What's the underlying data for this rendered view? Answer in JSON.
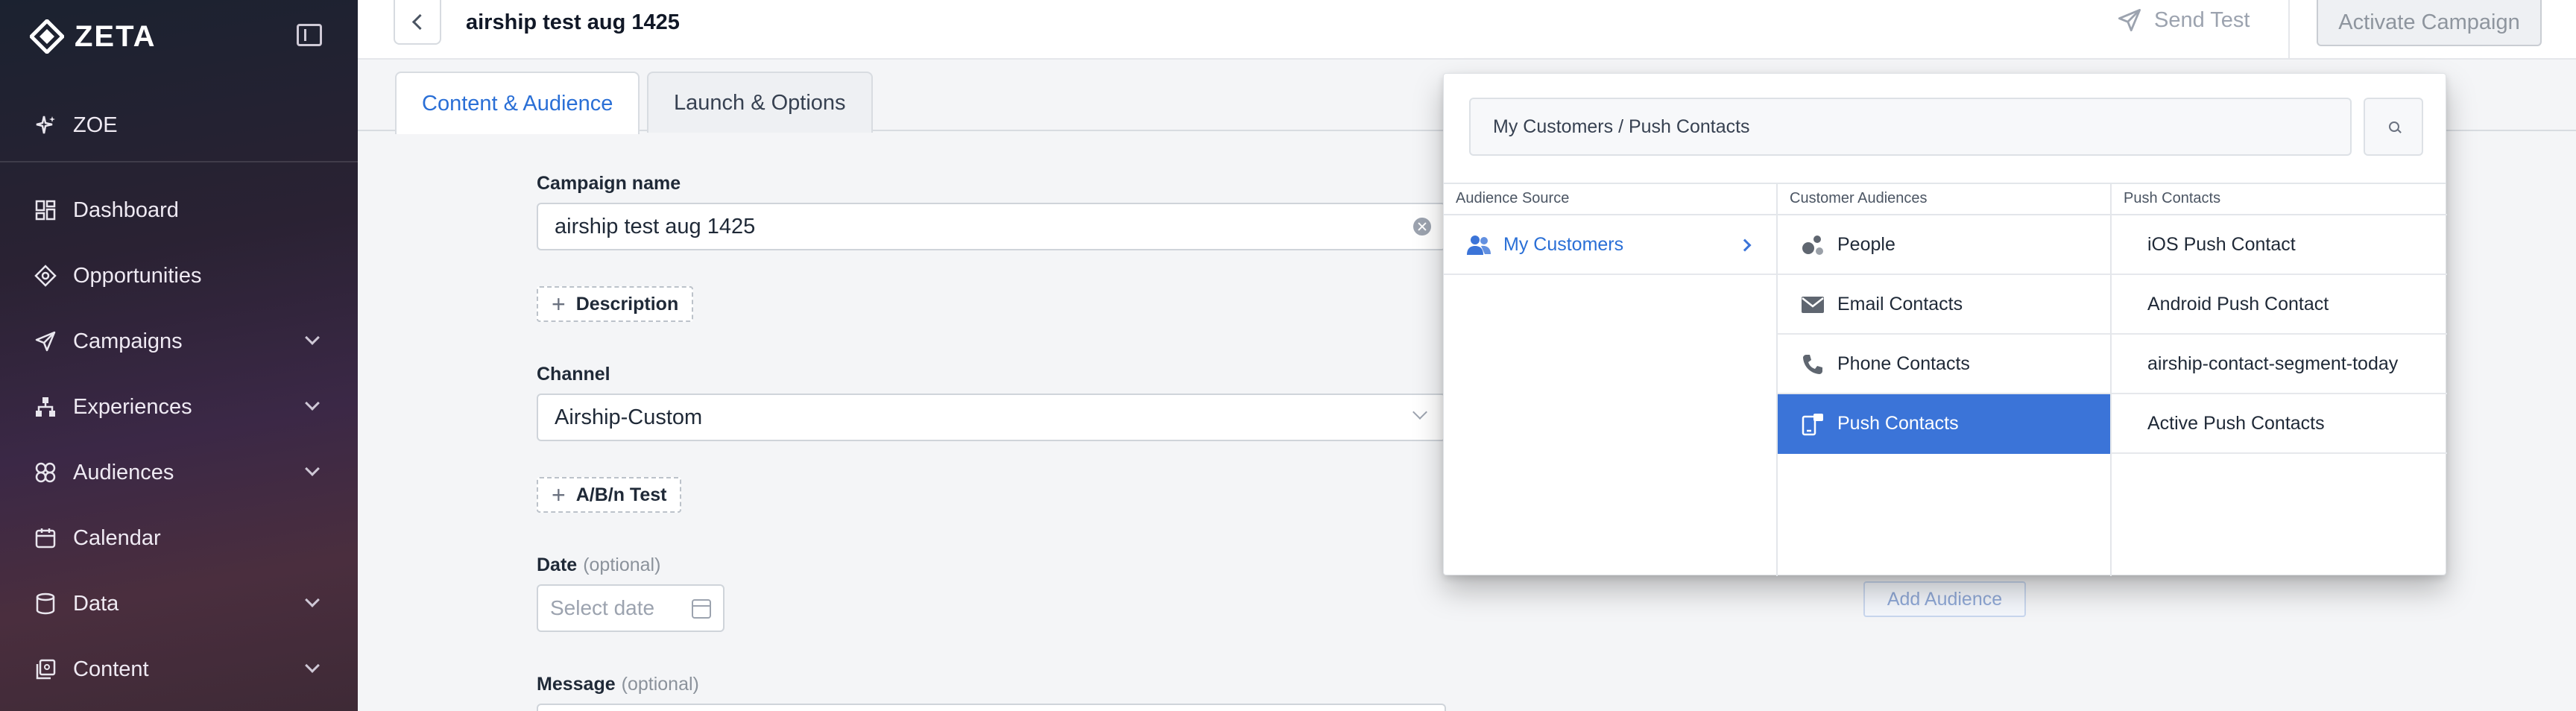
{
  "app": {
    "logo_text": "ZETA"
  },
  "sidebar": {
    "items": [
      {
        "label": "ZOE",
        "icon": "sparkle-icon",
        "expandable": false
      },
      {
        "label": "Dashboard",
        "icon": "grid-icon",
        "expandable": false
      },
      {
        "label": "Opportunities",
        "icon": "target-icon",
        "expandable": false
      },
      {
        "label": "Campaigns",
        "icon": "send-icon",
        "expandable": true
      },
      {
        "label": "Experiences",
        "icon": "hierarchy-icon",
        "expandable": true
      },
      {
        "label": "Audiences",
        "icon": "audience-icon",
        "expandable": true
      },
      {
        "label": "Calendar",
        "icon": "calendar-icon",
        "expandable": false
      },
      {
        "label": "Data",
        "icon": "database-icon",
        "expandable": true
      },
      {
        "label": "Content",
        "icon": "content-icon",
        "expandable": true
      }
    ]
  },
  "header": {
    "campaign_title": "airship test aug 1425",
    "send_test_label": "Send Test",
    "activate_label": "Activate Campaign"
  },
  "tabs": [
    {
      "label": "Content & Audience",
      "active": true
    },
    {
      "label": "Launch & Options",
      "active": false
    }
  ],
  "form": {
    "campaign_name_label": "Campaign name",
    "campaign_name_value": "airship test aug 1425",
    "description_button": "Description",
    "channel_label": "Channel",
    "channel_value": "Airship-Custom",
    "ab_test_button": "A/B/n Test",
    "date_label": "Date",
    "date_optional": "(optional)",
    "date_placeholder": "Select date",
    "message_label": "Message",
    "message_optional": "(optional)"
  },
  "audience_picker": {
    "path": "My Customers  / Push Contacts",
    "columns": {
      "source": {
        "header": "Audience Source",
        "items": [
          {
            "label": "My Customers",
            "selected": false
          }
        ]
      },
      "customer_audiences": {
        "header": "Customer Audiences",
        "items": [
          {
            "label": "People",
            "icon": "people-dots-icon",
            "selected": false
          },
          {
            "label": "Email Contacts",
            "icon": "envelope-icon",
            "selected": false
          },
          {
            "label": "Phone Contacts",
            "icon": "phone-icon",
            "selected": false
          },
          {
            "label": "Push Contacts",
            "icon": "push-device-icon",
            "selected": true
          }
        ]
      },
      "push_contacts": {
        "header": "Push Contacts",
        "items": [
          {
            "label": "iOS Push Contact"
          },
          {
            "label": "Android Push Contact"
          },
          {
            "label": "airship-contact-segment-today"
          },
          {
            "label": "Active Push Contacts"
          }
        ]
      }
    },
    "add_audience_label": "Add Audience"
  },
  "colors": {
    "accent": "#3b74d8",
    "tab_active_text": "#2a6fd6"
  }
}
